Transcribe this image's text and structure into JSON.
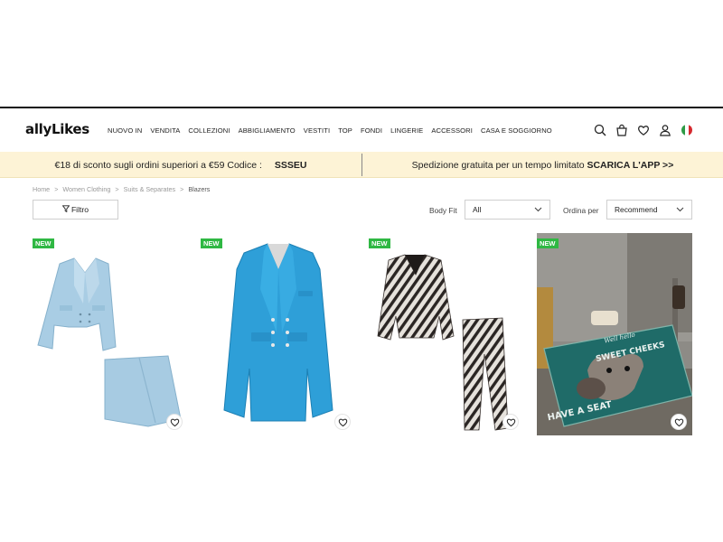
{
  "header": {
    "logo": "allyLikes",
    "nav": [
      "NUOVO IN",
      "VENDITA",
      "COLLEZIONI",
      "ABBIGLIAMENTO",
      "VESTITI",
      "TOP",
      "FONDI",
      "LINGERIE",
      "ACCESSORI",
      "CASA E SOGGIORNO"
    ]
  },
  "promo": {
    "left_text": "€18 di sconto sugli ordini superiori a €59 Codice :",
    "left_code": "SSSEU",
    "right_text": "Spedizione gratuita per un tempo limitato",
    "right_cta": "SCARICA L'APP >>"
  },
  "breadcrumb": [
    "Home",
    ">",
    "Women Clothing",
    ">",
    "Suits & Separates",
    ">",
    "Blazers"
  ],
  "filters": {
    "filter_button": "Filtro",
    "body_fit_label": "Body Fit",
    "body_fit_value": "All",
    "sort_label": "Ordina per",
    "sort_value": "Recommend"
  },
  "products": [
    {
      "badge": "NEW"
    },
    {
      "badge": "NEW"
    },
    {
      "badge": "NEW"
    },
    {
      "badge": "NEW",
      "rug_line1": "Well hello",
      "rug_line2": "SWEET CHEEKS",
      "rug_line3": "HAVE A SEAT"
    }
  ],
  "colors": {
    "promo_bg": "#fdf3d6",
    "badge_green": "#2fb843",
    "accent_text": "#222222"
  }
}
